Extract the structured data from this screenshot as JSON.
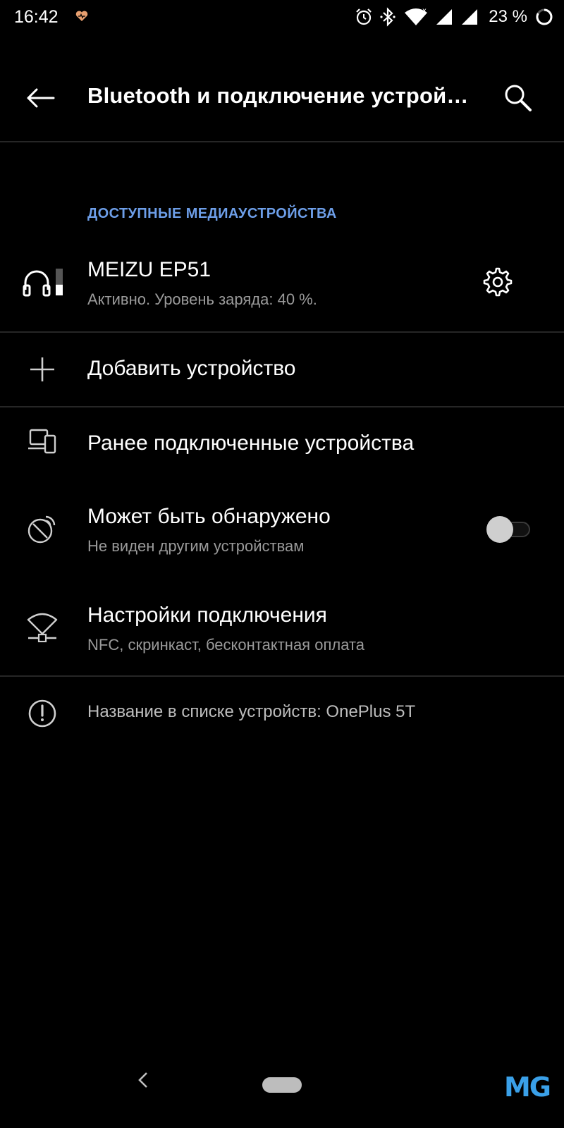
{
  "status_bar": {
    "time": "16:42",
    "battery_percent": "23 %",
    "icons": [
      "heart-icon",
      "alarm-icon",
      "bluetooth-icon",
      "wifi-icon",
      "signal-icon",
      "signal-icon",
      "battery-ring-icon"
    ]
  },
  "app_bar": {
    "title": "Bluetooth и подключение устрой…",
    "back_icon": "arrow-left-icon",
    "search_icon": "search-icon"
  },
  "section": {
    "header": "ДОСТУПНЫЕ МЕДИАУСТРОЙСТВА"
  },
  "media_device": {
    "name": "MEIZU EP51",
    "status": "Активно. Уровень заряда: 40 %.",
    "battery_level": 0.4,
    "icon": "headphones-icon",
    "settings_icon": "gear-icon"
  },
  "add_device": {
    "label": "Добавить устройство",
    "icon": "plus-icon"
  },
  "previously_connected": {
    "label": "Ранее подключенные устройства",
    "icon": "devices-icon"
  },
  "discoverable": {
    "label": "Может быть обнаружено",
    "subtitle": "Не виден другим устройствам",
    "enabled": false,
    "icon": "radar-icon"
  },
  "connection_prefs": {
    "label": "Настройки подключения",
    "subtitle": "NFC, скринкаст, бесконтактная оплата",
    "icon": "network-icon"
  },
  "info": {
    "text": "Название в списке устройств: OnePlus 5T",
    "icon": "info-icon"
  },
  "nav_bar": {
    "watermark": "MG"
  },
  "colors": {
    "background": "#000000",
    "accent": "#6d9ee8",
    "secondary_text": "#9a9a9a"
  }
}
